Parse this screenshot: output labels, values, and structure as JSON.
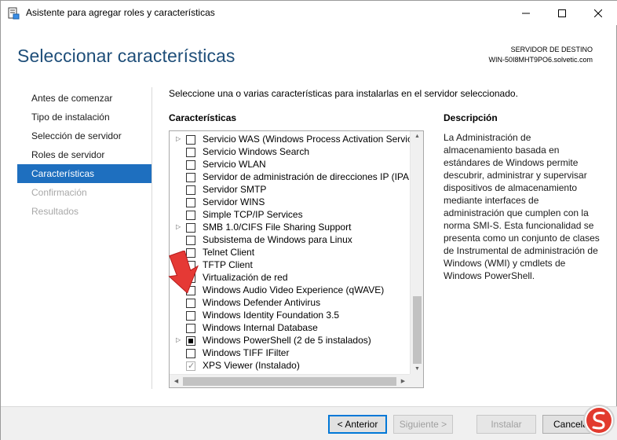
{
  "window": {
    "title": "Asistente para agregar roles y características"
  },
  "header": {
    "heading": "Seleccionar características",
    "dest_label": "SERVIDOR DE DESTINO",
    "dest_server": "WIN-50I8MHT9PO6.solvetic.com"
  },
  "nav": {
    "items": [
      {
        "label": "Antes de comenzar",
        "state": "normal"
      },
      {
        "label": "Tipo de instalación",
        "state": "normal"
      },
      {
        "label": "Selección de servidor",
        "state": "normal"
      },
      {
        "label": "Roles de servidor",
        "state": "normal"
      },
      {
        "label": "Características",
        "state": "active"
      },
      {
        "label": "Confirmación",
        "state": "disabled"
      },
      {
        "label": "Resultados",
        "state": "disabled"
      }
    ]
  },
  "main": {
    "instruction": "Seleccione una o varias características para instalarlas en el servidor seleccionado.",
    "features_header": "Características",
    "description_header": "Descripción",
    "description": "La Administración de almacenamiento basada en estándares de Windows permite descubrir, administrar y supervisar dispositivos de almacenamiento mediante interfaces de administración que cumplen con la norma SMI-S. Esta funcionalidad se presenta como un conjunto de clases de Instrumental de administración de Windows (WMI) y cmdlets de Windows PowerShell.",
    "features": [
      {
        "label": "Servicio WAS (Windows Process Activation Service",
        "expandable": true,
        "check": "unchecked"
      },
      {
        "label": "Servicio Windows Search",
        "expandable": false,
        "check": "unchecked"
      },
      {
        "label": "Servicio WLAN",
        "expandable": false,
        "check": "unchecked"
      },
      {
        "label": "Servidor de administración de direcciones IP (IPAM",
        "expandable": false,
        "check": "unchecked"
      },
      {
        "label": "Servidor SMTP",
        "expandable": false,
        "check": "unchecked"
      },
      {
        "label": "Servidor WINS",
        "expandable": false,
        "check": "unchecked"
      },
      {
        "label": "Simple TCP/IP Services",
        "expandable": false,
        "check": "unchecked"
      },
      {
        "label": "SMB 1.0/CIFS File Sharing Support",
        "expandable": true,
        "check": "unchecked"
      },
      {
        "label": "Subsistema de Windows para Linux",
        "expandable": false,
        "check": "unchecked"
      },
      {
        "label": "Telnet Client",
        "expandable": false,
        "check": "unchecked"
      },
      {
        "label": "TFTP Client",
        "expandable": false,
        "check": "unchecked"
      },
      {
        "label": "Virtualización de red",
        "expandable": false,
        "check": "unchecked"
      },
      {
        "label": "Windows Audio Video Experience (qWAVE)",
        "expandable": false,
        "check": "unchecked"
      },
      {
        "label": "Windows Defender Antivirus",
        "expandable": false,
        "check": "unchecked"
      },
      {
        "label": "Windows Identity Foundation 3.5",
        "expandable": false,
        "check": "unchecked"
      },
      {
        "label": "Windows Internal Database",
        "expandable": false,
        "check": "unchecked"
      },
      {
        "label": "Windows PowerShell (2 de 5 instalados)",
        "expandable": true,
        "check": "partial"
      },
      {
        "label": "Windows TIFF IFilter",
        "expandable": false,
        "check": "unchecked"
      },
      {
        "label": "XPS Viewer (Instalado)",
        "expandable": false,
        "check": "installed"
      }
    ]
  },
  "footer": {
    "back": "< Anterior",
    "next": "Siguiente >",
    "install": "Instalar",
    "cancel": "Cancelar"
  },
  "colors": {
    "accent": "#1e6fbf",
    "heading": "#1e4e79",
    "arrow": "#e53935"
  }
}
